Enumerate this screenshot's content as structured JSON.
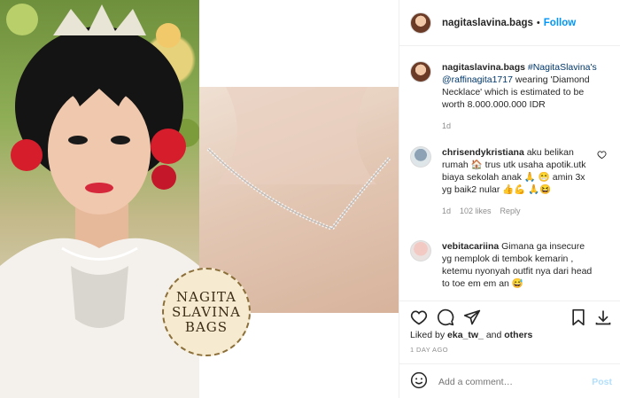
{
  "header": {
    "username": "nagitaslavina.bags",
    "separator": "•",
    "follow_label": "Follow"
  },
  "media": {
    "stamp_text": "NAGITA\nSLAVINA\nBAGS",
    "image_left": "bride-portrait-photo",
    "image_right": "diamond-necklace-photo"
  },
  "caption": {
    "username": "nagitaslavina.bags",
    "hashtag": "#NagitaSlavina's",
    "mention": "@raffinagita1717",
    "text": " wearing 'Diamond Necklace' which is estimated to be worth 8.000.000.000 IDR",
    "time": "1d"
  },
  "comments": [
    {
      "username": "chrisendykristiana",
      "text": "aku belikan rumah 🏠 trus utk usaha apotik.utk biaya sekolah anak 🙏 😁 amin 3x yg baik2 nular 👍💪 🙏😆",
      "time": "1d",
      "likes": "102 likes",
      "reply": "Reply"
    },
    {
      "username": "vebitacariina",
      "text": "Gimana ga insecure yg nemplok di tembok kemarin , ketemu nyonyah outfit nya dari head to toe em em an 😅"
    }
  ],
  "actions": {
    "liked_prefix": "Liked by ",
    "liked_user": "eka_tw_",
    "liked_middle": " and ",
    "liked_others": "others",
    "time_ago": "1 DAY AGO",
    "comment_placeholder": "Add a comment…",
    "post_label": "Post"
  },
  "colors": {
    "follow": "#0095f6",
    "link": "#00376b",
    "muted": "#8e8e8e",
    "post_disabled": "#b2dffc"
  }
}
